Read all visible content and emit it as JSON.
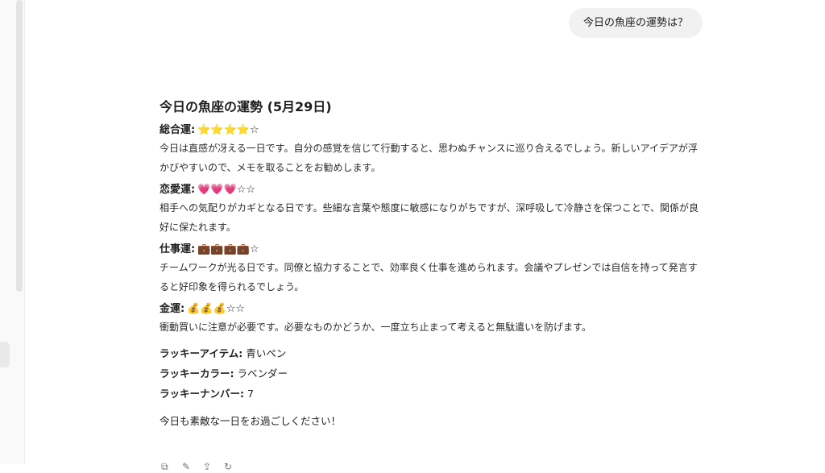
{
  "user_message": "今日の魚座の運勢は？",
  "response": {
    "title": "今日の魚座の運勢 (5月29日)",
    "sections": [
      {
        "label": "総合運:",
        "rating": "⭐⭐⭐⭐☆",
        "text": "今日は直感が冴える一日です。自分の感覚を信じて行動すると、思わぬチャンスに巡り合えるでしょう。新しいアイデアが浮かびやすいので、メモを取ることをお勧めします。"
      },
      {
        "label": "恋愛運:",
        "rating": "💗💗💗☆☆",
        "text": "相手への気配りがカギとなる日です。些細な言葉や態度に敏感になりがちですが、深呼吸して冷静さを保つことで、関係が良好に保たれます。"
      },
      {
        "label": "仕事運:",
        "rating": "💼💼💼💼☆",
        "text": "チームワークが光る日です。同僚と協力することで、効率良く仕事を進められます。会議やプレゼンでは自信を持って発言すると好印象を得られるでしょう。"
      },
      {
        "label": "金運:",
        "rating": "💰💰💰☆☆",
        "text": "衝動買いに注意が必要です。必要なものかどうか、一度立ち止まって考えると無駄遣いを防げます。"
      }
    ],
    "lucky": [
      {
        "label": "ラッキーアイテム:",
        "value": " 青いペン"
      },
      {
        "label": "ラッキーカラー:",
        "value": " ラベンダー"
      },
      {
        "label": "ラッキーナンバー:",
        "value": " 7"
      }
    ],
    "closing": "今日も素敵な一日をお過ごしください！"
  },
  "actions": {
    "copy": "⧉",
    "edit": "✎",
    "share": "⇪",
    "regenerate": "↻"
  }
}
